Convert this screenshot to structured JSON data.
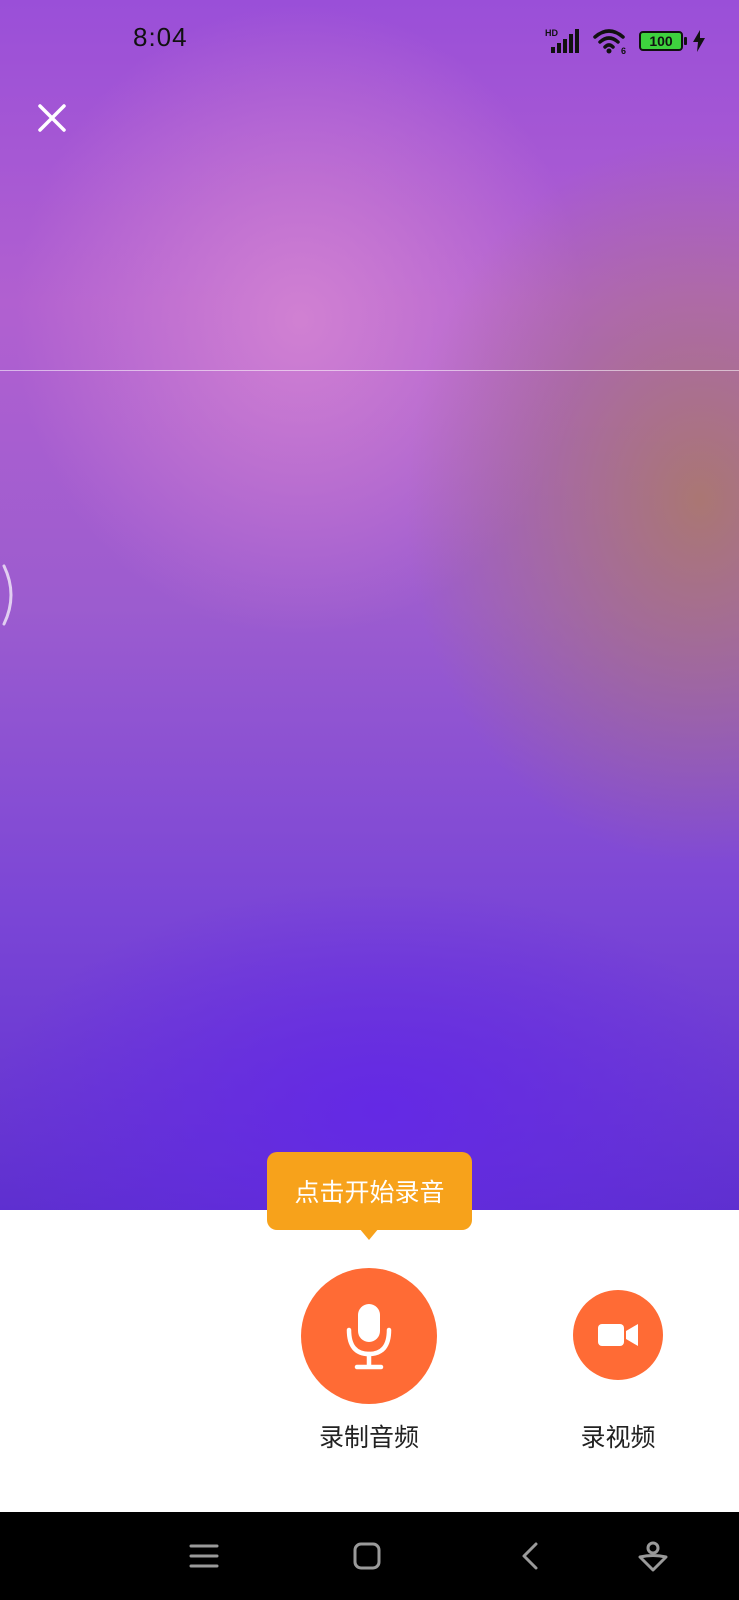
{
  "status_bar": {
    "time": "8:04",
    "network_label": "HD",
    "wifi_label": "6",
    "battery_level": "100",
    "icons": [
      "signal-icon",
      "wifi-icon",
      "battery-icon",
      "charging-icon"
    ]
  },
  "top_bar": {
    "close_icon": "close-icon"
  },
  "recording": {
    "tooltip": "点击开始录音",
    "audio_label": "录制音频",
    "video_label": "录视频",
    "audio_icon": "microphone-icon",
    "video_icon": "video-camera-icon"
  },
  "nav_bar": {
    "icons": [
      "menu-icon",
      "home-icon",
      "back-icon",
      "assistant-icon"
    ]
  },
  "colors": {
    "accent": "#ff6b35",
    "tooltip": "#f7a21b",
    "panel": "#ffffff",
    "navbar": "#000000"
  }
}
